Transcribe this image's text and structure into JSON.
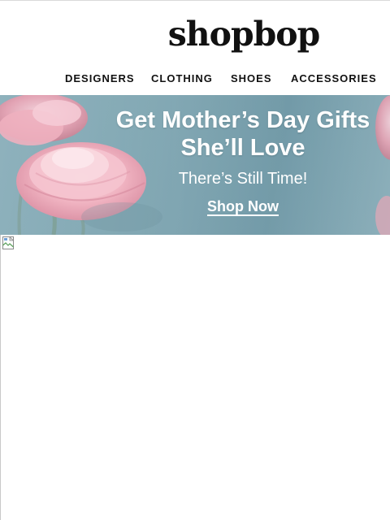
{
  "header": {
    "logo_text": "shopbop"
  },
  "nav": {
    "items": [
      {
        "label": "DESIGNERS"
      },
      {
        "label": "CLOTHING"
      },
      {
        "label": "SHOES"
      },
      {
        "label": "ACCESSORIES"
      }
    ]
  },
  "banner": {
    "title": "Get Mother’s Day Gifts She’ll Love",
    "subtitle": "There’s Still Time!",
    "cta_label": "Shop Now",
    "colors": {
      "background": "#7fa6b2",
      "flower": "#f2b6c4",
      "text": "#ffffff"
    }
  },
  "content": {
    "broken_image_icon": "broken-image-icon"
  }
}
